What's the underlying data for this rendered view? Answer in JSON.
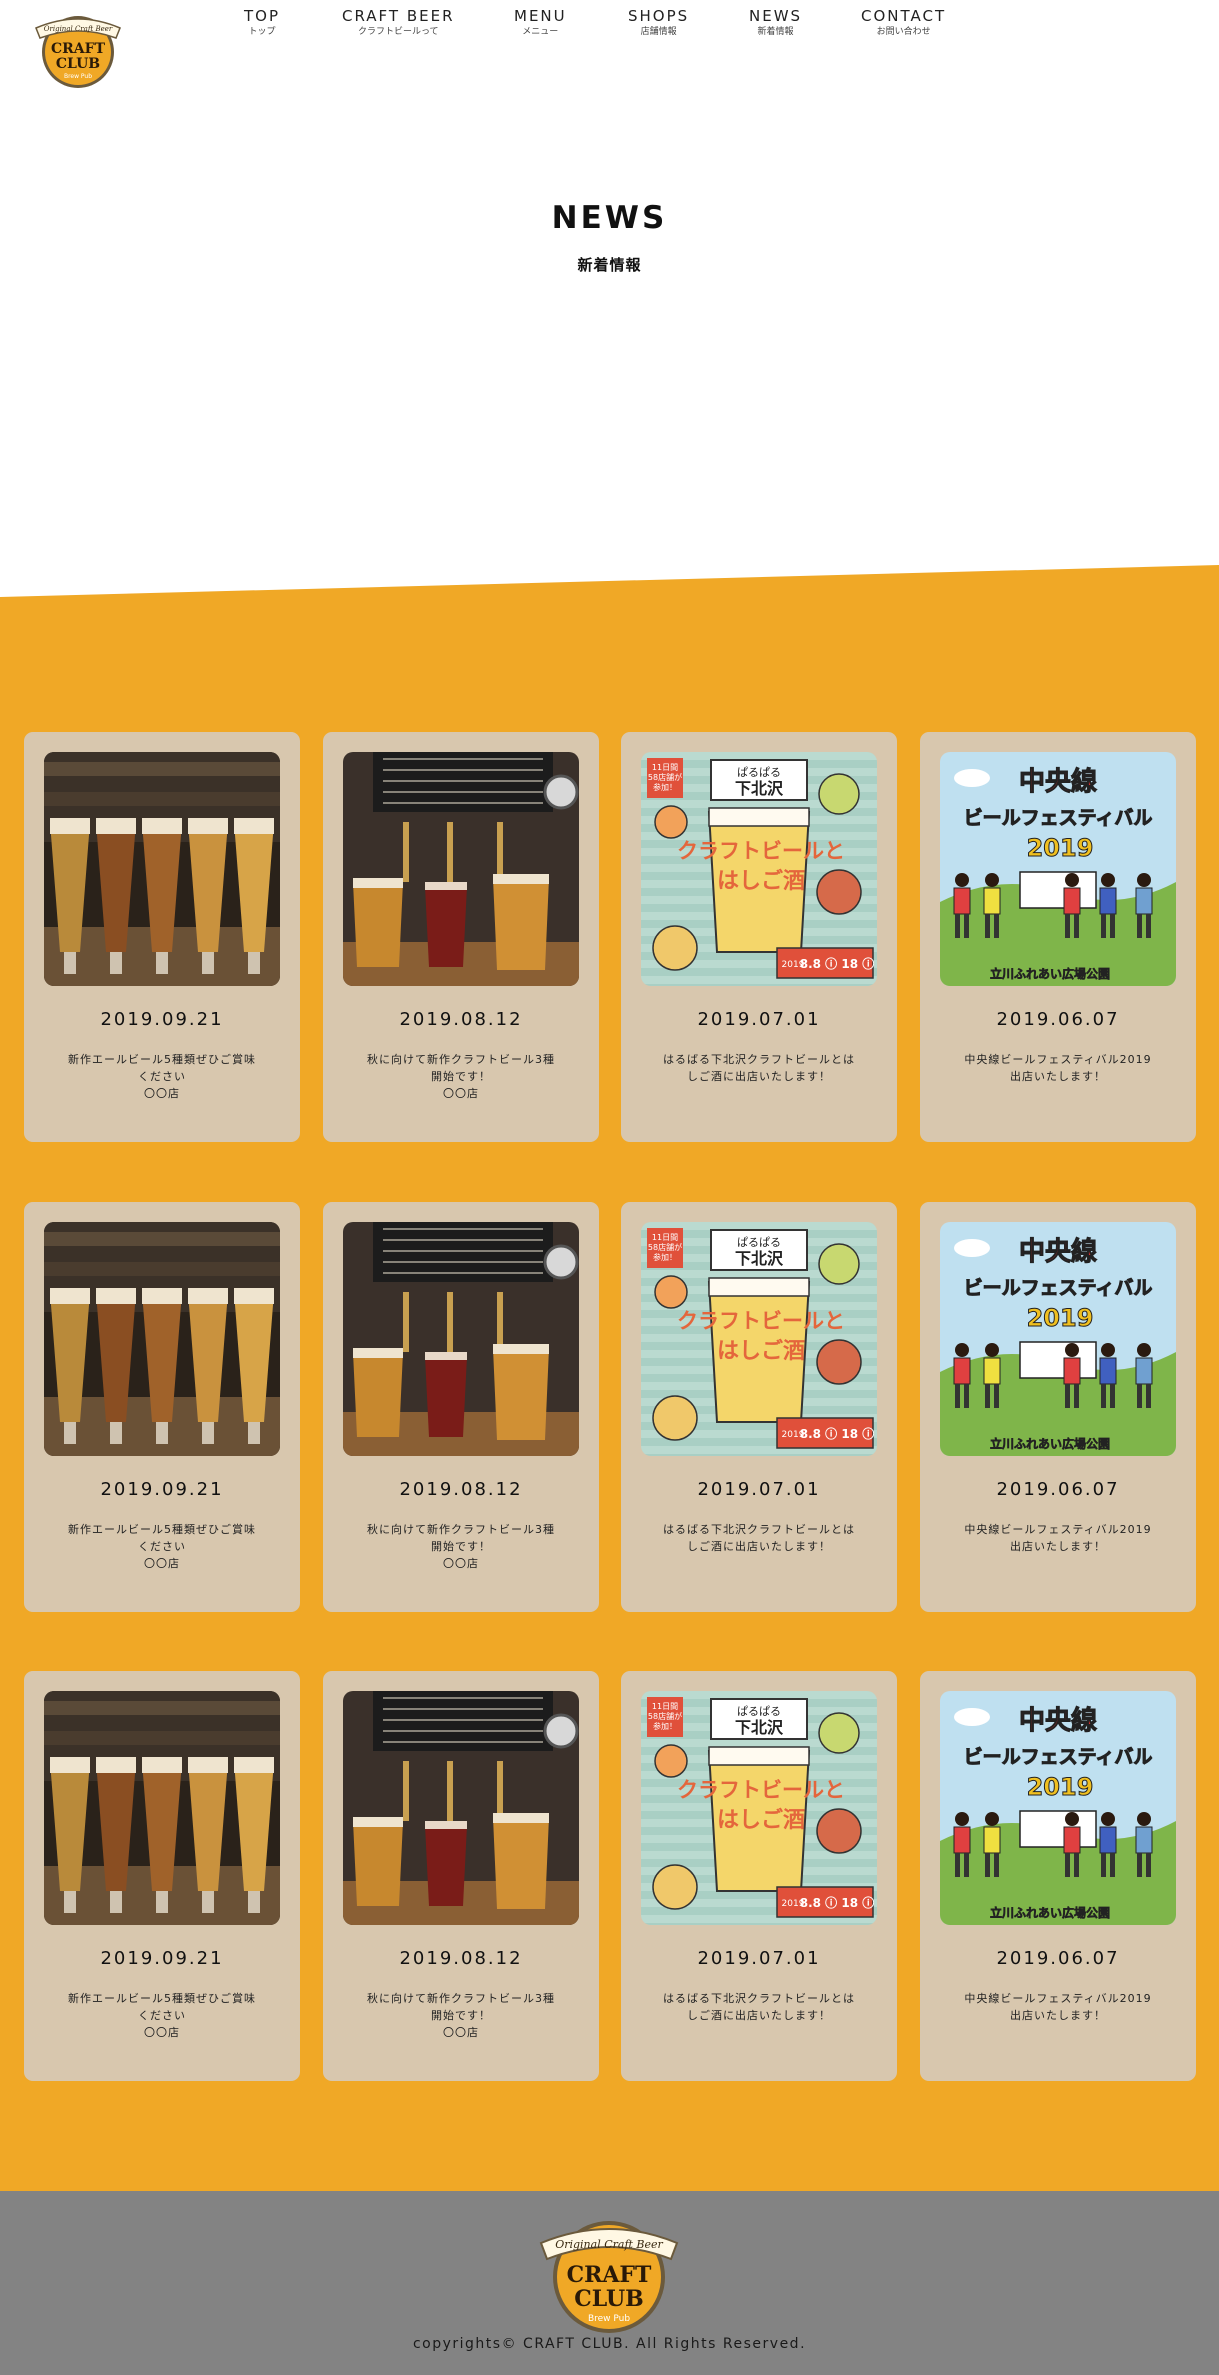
{
  "brand": {
    "logo_top": "Original Craft Beer",
    "logo_main1": "CRAFT",
    "logo_main2": "CLUB",
    "logo_sub1": "Brew",
    "logo_sub2": "Pub"
  },
  "nav": [
    {
      "en": "TOP",
      "ja": "トップ"
    },
    {
      "en": "CRAFT BEER",
      "ja": "クラフトビールって"
    },
    {
      "en": "MENU",
      "ja": "メニュー"
    },
    {
      "en": "SHOPS",
      "ja": "店舗情報"
    },
    {
      "en": "NEWS",
      "ja": "新着情報"
    },
    {
      "en": "CONTACT",
      "ja": "お問い合わせ"
    }
  ],
  "hero": {
    "title": "NEWS",
    "subtitle": "新着情報"
  },
  "colors": {
    "orange": "#f0a826",
    "card": "#d8c7ae",
    "footer": "#838383"
  },
  "news": [
    {
      "date": "2019.09.21",
      "text": "新作エールビール5種類ぜひご賞味\nください\n〇〇店",
      "image": "beer-glasses-row-photo"
    },
    {
      "date": "2019.08.12",
      "text": "秋に向けて新作クラフトビール3種\n開始です！\n〇〇店",
      "image": "beer-taps-photo"
    },
    {
      "date": "2019.07.01",
      "text": "はるばる下北沢クラフトビールとは\nしご酒に出店いたします！",
      "image": "shimokitazawa-poster"
    },
    {
      "date": "2019.06.07",
      "text": "中央線ビールフェスティバル2019\n出店いたします！",
      "image": "chuo-line-festival-poster"
    },
    {
      "date": "2019.09.21",
      "text": "新作エールビール5種類ぜひご賞味\nください\n〇〇店",
      "image": "beer-glasses-row-photo"
    },
    {
      "date": "2019.08.12",
      "text": "秋に向けて新作クラフトビール3種\n開始です！\n〇〇店",
      "image": "beer-taps-photo"
    },
    {
      "date": "2019.07.01",
      "text": "はるばる下北沢クラフトビールとは\nしご酒に出店いたします！",
      "image": "shimokitazawa-poster"
    },
    {
      "date": "2019.06.07",
      "text": "中央線ビールフェスティバル2019\n出店いたします！",
      "image": "chuo-line-festival-poster"
    },
    {
      "date": "2019.09.21",
      "text": "新作エールビール5種類ぜひご賞味\nください\n〇〇店",
      "image": "beer-glasses-row-photo"
    },
    {
      "date": "2019.08.12",
      "text": "秋に向けて新作クラフトビール3種\n開始です！\n〇〇店",
      "image": "beer-taps-photo"
    },
    {
      "date": "2019.07.01",
      "text": "はるばる下北沢クラフトビールとは\nしご酒に出店いたします！",
      "image": "shimokitazawa-poster"
    },
    {
      "date": "2019.06.07",
      "text": "中央線ビールフェスティバル2019\n出店いたします！",
      "image": "chuo-line-festival-poster"
    }
  ],
  "posters": {
    "shimokitazawa": {
      "badge": "11日間\n58店舗が\n参加！",
      "top": "ぱるぱる",
      "place": "下北沢",
      "title1": "クラフトビールと",
      "title2": "はしご酒",
      "year": "2019",
      "dates": "8.8 ⓘ 18 ⓘ"
    },
    "chuo": {
      "line1": "中央線",
      "line2": "ビールフェスティバル",
      "year": "2019",
      "venue": "立川ふれあい広場公園"
    }
  },
  "footer": {
    "copyright": "copyrights© CRAFT CLUB. All Rights Reserved."
  }
}
